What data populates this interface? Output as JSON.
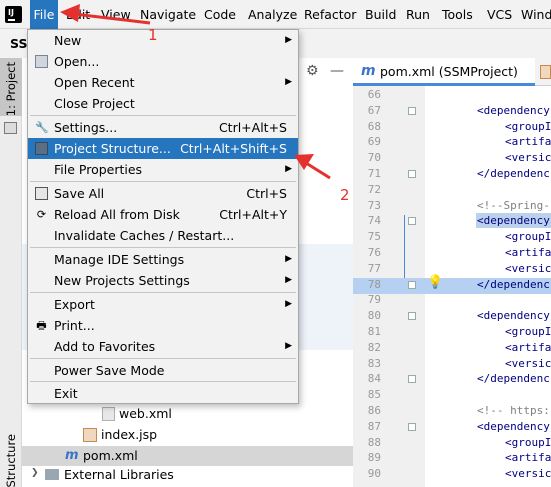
{
  "menubar": {
    "items": [
      "File",
      "Edit",
      "View",
      "Navigate",
      "Code",
      "Analyze",
      "Refactor",
      "Build",
      "Run",
      "Tools",
      "VCS",
      "Wind"
    ]
  },
  "toolbar": {
    "project_name": "SSM"
  },
  "side_tabs": {
    "project": "1: Project",
    "structure": "Structure"
  },
  "editor_tab": {
    "label": "pom.xml (SSMProject)"
  },
  "file_menu": {
    "items": [
      {
        "label": "New",
        "submenu": true
      },
      {
        "label": "Open..."
      },
      {
        "label": "Open Recent",
        "submenu": true
      },
      {
        "label": "Close Project"
      },
      {
        "label": "Settings...",
        "shortcut": "Ctrl+Alt+S"
      },
      {
        "label": "Project Structure...",
        "shortcut": "Ctrl+Alt+Shift+S",
        "selected": true
      },
      {
        "label": "File Properties",
        "submenu": true
      },
      {
        "label": "Save All",
        "shortcut": "Ctrl+S"
      },
      {
        "label": "Reload All from Disk",
        "shortcut": "Ctrl+Alt+Y"
      },
      {
        "label": "Invalidate Caches / Restart..."
      },
      {
        "label": "Manage IDE Settings",
        "submenu": true
      },
      {
        "label": "New Projects Settings",
        "submenu": true
      },
      {
        "label": "Export",
        "submenu": true
      },
      {
        "label": "Print..."
      },
      {
        "label": "Add to Favorites",
        "submenu": true
      },
      {
        "label": "Power Save Mode"
      },
      {
        "label": "Exit"
      }
    ]
  },
  "project_tree": {
    "items": [
      "web.xml",
      "index.jsp",
      "pom.xml",
      "External Libraries"
    ]
  },
  "editor": {
    "lines": [
      {
        "n": "66",
        "text": ""
      },
      {
        "n": "67",
        "text": "<dependency"
      },
      {
        "n": "68",
        "text": "<groupI"
      },
      {
        "n": "69",
        "text": "<artifa"
      },
      {
        "n": "70",
        "text": "<versic"
      },
      {
        "n": "71",
        "text": "</dependenc"
      },
      {
        "n": "72",
        "text": ""
      },
      {
        "n": "73",
        "text": "<!--Spring-"
      },
      {
        "n": "74",
        "text": "<dependency"
      },
      {
        "n": "75",
        "text": "<groupI"
      },
      {
        "n": "76",
        "text": "<artifa"
      },
      {
        "n": "77",
        "text": "<versic"
      },
      {
        "n": "78",
        "text": "</dependenc"
      },
      {
        "n": "79",
        "text": ""
      },
      {
        "n": "80",
        "text": "<dependency"
      },
      {
        "n": "81",
        "text": "<groupI"
      },
      {
        "n": "82",
        "text": "<artifa"
      },
      {
        "n": "83",
        "text": "<versic"
      },
      {
        "n": "84",
        "text": "</dependenc"
      },
      {
        "n": "85",
        "text": ""
      },
      {
        "n": "86",
        "text": "<!-- https:"
      },
      {
        "n": "87",
        "text": "<dependency"
      },
      {
        "n": "88",
        "text": "<groupI"
      },
      {
        "n": "89",
        "text": "<artifa"
      },
      {
        "n": "90",
        "text": "<versic"
      }
    ]
  },
  "annotations": {
    "one": "1",
    "two": "2"
  },
  "colors": {
    "accent": "#2675bf",
    "annotation": "#e5312e",
    "tag": "#000080",
    "highlight_line": "#b5d0f0"
  }
}
